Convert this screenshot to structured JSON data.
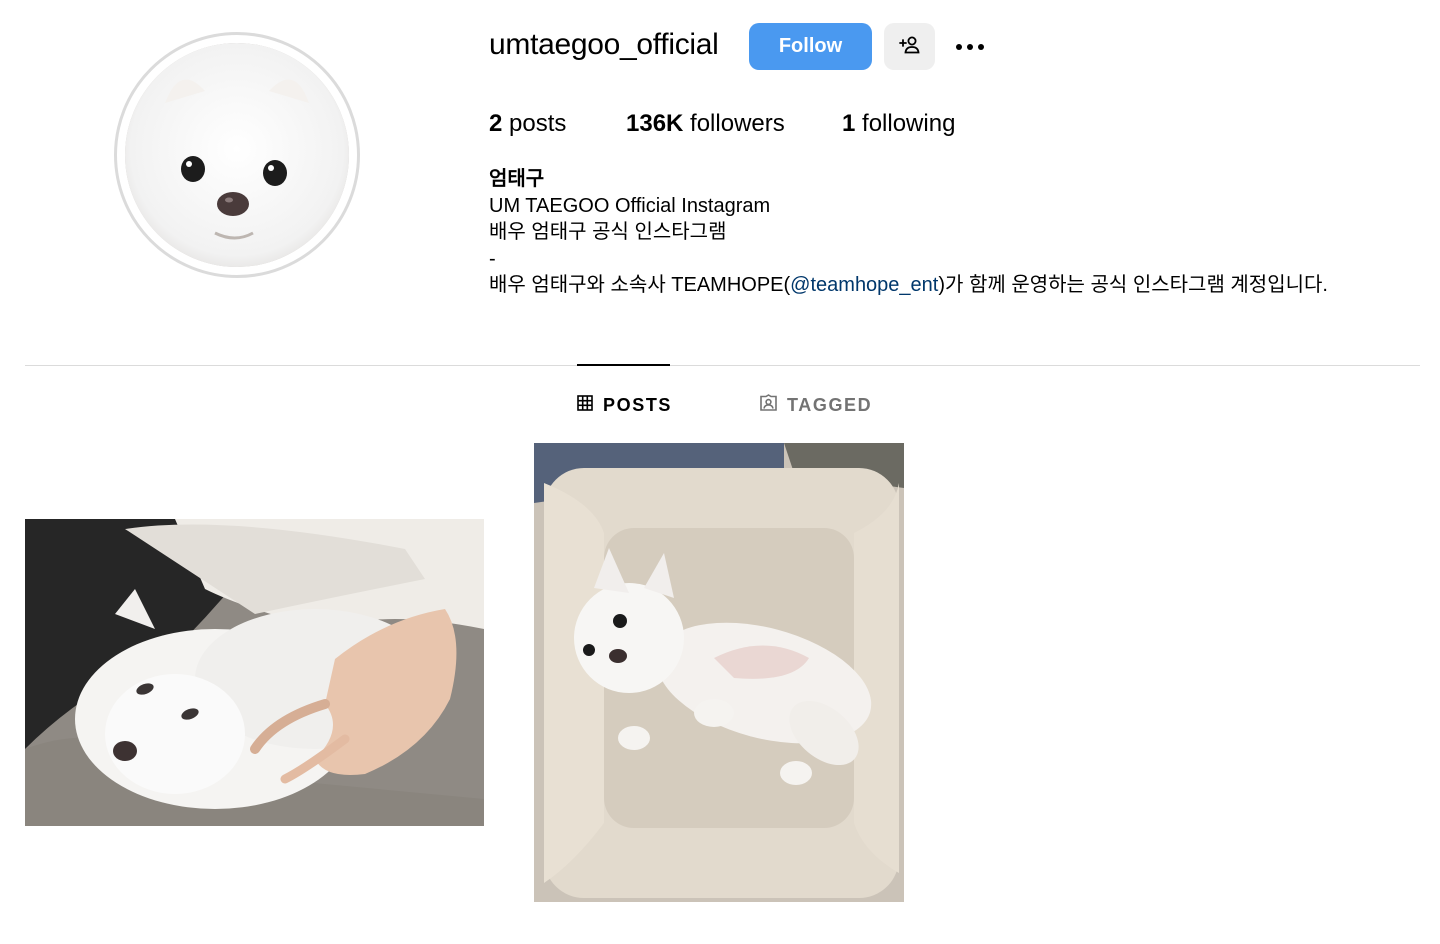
{
  "profile": {
    "username": "umtaegoo_official",
    "follow_label": "Follow",
    "suggest_icon": "add-person-icon",
    "more_icon": "more-options-icon"
  },
  "stats": {
    "posts_count": "2",
    "posts_label": " posts",
    "followers_count": "136K",
    "followers_label": " followers",
    "following_count": "1",
    "following_label": " following"
  },
  "bio": {
    "name": "엄태구",
    "line1": "UM TAEGOO Official Instagram",
    "line2": "배우 엄태구 공식 인스타그램",
    "line3": "-",
    "line4_prefix": "배우 엄태구와 소속사 TEAMHOPE(",
    "line4_mention": "@teamhope_ent",
    "line4_suffix": ")가 함께 운영하는 공식 인스타그램 계정입니다."
  },
  "tabs": [
    {
      "label": "POSTS",
      "icon": "grid-icon",
      "active": true
    },
    {
      "label": "TAGGED",
      "icon": "tagged-icon",
      "active": false
    }
  ],
  "colors": {
    "follow_button": "#4a99f0",
    "mention": "#00376b",
    "divider": "#dbdbdb",
    "inactive_tab": "#737373"
  }
}
